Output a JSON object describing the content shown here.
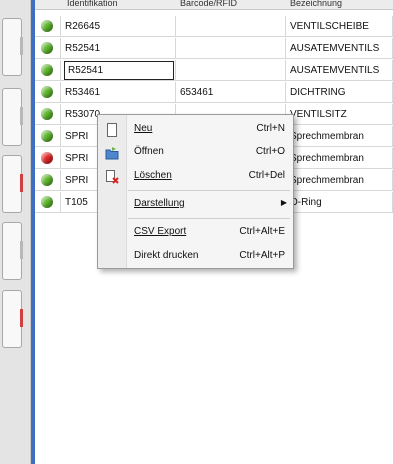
{
  "columns": [
    "Identifikation",
    "Barcode/RFID",
    "Bezeichnung"
  ],
  "rows": [
    {
      "status": "green",
      "id": "R26645",
      "barcode": "",
      "desc": "VENTILSCHEIBE"
    },
    {
      "status": "green",
      "id": "R52541",
      "barcode": "",
      "desc": "AUSATEMVENTILS"
    },
    {
      "status": "green",
      "id": "R52541",
      "barcode": "",
      "desc": "AUSATEMVENTILS"
    },
    {
      "status": "green",
      "id": "R53461",
      "barcode": "653461",
      "desc": "DICHTRING"
    },
    {
      "status": "green",
      "id": "R53070",
      "barcode": "",
      "desc": "VENTILSITZ"
    },
    {
      "status": "green",
      "id": "SPRI",
      "barcode": "",
      "desc": "Sprechmembran"
    },
    {
      "status": "red",
      "id": "SPRI",
      "barcode": "",
      "desc": "Sprechmembran"
    },
    {
      "status": "green",
      "id": "SPRI",
      "barcode": "",
      "desc": "Sprechmembran"
    },
    {
      "status": "green",
      "id": "T105",
      "barcode": "",
      "desc": "O-Ring"
    }
  ],
  "edit_value": "R52541",
  "context_menu": {
    "new": {
      "label": "Neu",
      "shortcut": "Ctrl+N",
      "icon": "new-document-icon"
    },
    "open": {
      "label": "Öffnen",
      "shortcut": "Ctrl+O",
      "icon": "open-folder-icon"
    },
    "delete": {
      "label": "Löschen",
      "shortcut": "Ctrl+Del",
      "icon": "delete-document-icon"
    },
    "display": {
      "label": "Darstellung",
      "icon": "submenu-arrow-icon"
    },
    "csv": {
      "label": "CSV Export",
      "shortcut": "Ctrl+Alt+E"
    },
    "print": {
      "label": "Direkt drucken",
      "shortcut": "Ctrl+Alt+P"
    }
  },
  "colors": {
    "status_green": "#5cb52a",
    "status_red": "#e02424",
    "accent_blue": "#3f6fc3"
  }
}
